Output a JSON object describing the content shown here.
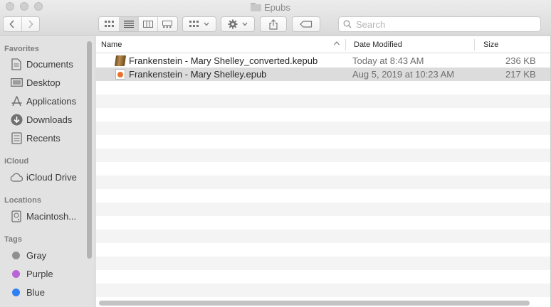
{
  "window": {
    "title": "Epubs"
  },
  "toolbar": {
    "back_icon": "chevron-left-icon",
    "forward_icon": "chevron-right-icon",
    "view_modes": [
      "icon-view",
      "list-view",
      "column-view",
      "gallery-view"
    ],
    "active_view": "list-view",
    "search_placeholder": "Search"
  },
  "sidebar": {
    "favorites_header": "Favorites",
    "favorites": [
      {
        "label": "Documents",
        "icon": "documents-icon"
      },
      {
        "label": "Desktop",
        "icon": "desktop-icon"
      },
      {
        "label": "Applications",
        "icon": "applications-icon"
      },
      {
        "label": "Downloads",
        "icon": "downloads-icon"
      },
      {
        "label": "Recents",
        "icon": "recents-icon"
      }
    ],
    "icloud_header": "iCloud",
    "icloud": [
      {
        "label": "iCloud Drive",
        "icon": "cloud-icon"
      }
    ],
    "locations_header": "Locations",
    "locations": [
      {
        "label": "Macintosh...",
        "icon": "hard-drive-icon"
      }
    ],
    "tags_header": "Tags",
    "tags": [
      {
        "label": "Gray",
        "color": "#8e8e93"
      },
      {
        "label": "Purple",
        "color": "#b865d6"
      },
      {
        "label": "Blue",
        "color": "#2f7ff5"
      }
    ]
  },
  "list": {
    "columns": {
      "name": "Name",
      "date": "Date Modified",
      "size": "Size"
    },
    "sort_column": "name",
    "files": [
      {
        "name": "Frankenstein - Mary Shelley_converted.kepub",
        "date": "Today at 8:43 AM",
        "size": "236 KB",
        "icon": "kepub-book-icon"
      },
      {
        "name": "Frankenstein - Mary Shelley.epub",
        "date": "Aug 5, 2019 at 10:23 AM",
        "size": "217 KB",
        "icon": "epub-file-icon",
        "selected": true
      }
    ]
  }
}
